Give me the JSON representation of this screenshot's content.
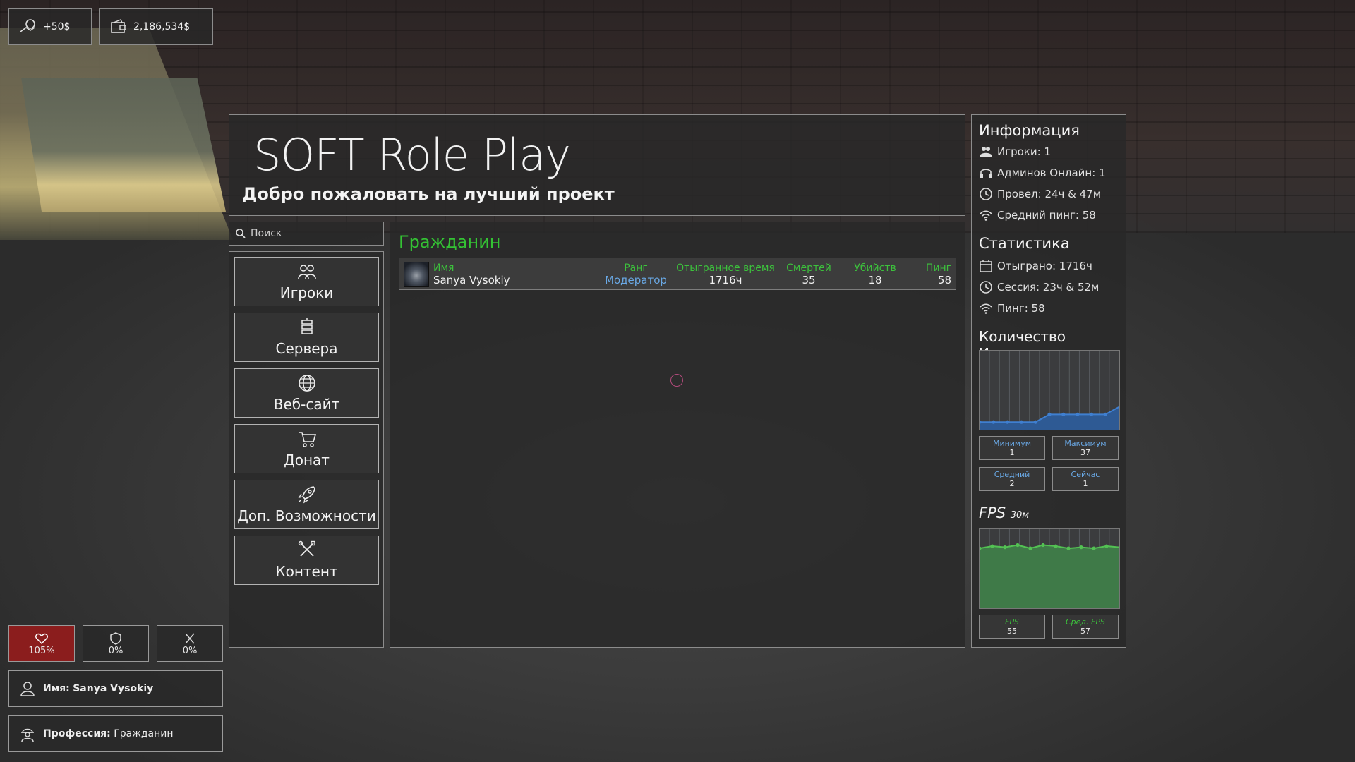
{
  "hud": {
    "income": "+50$",
    "balance": "2,186,534$",
    "health": "105%",
    "armor": "0%",
    "hunger": "0%",
    "name_label": "Имя:",
    "name_value": "Sanya Vysokiy",
    "job_label": "Профессия:",
    "job_value": "Гражданин"
  },
  "header": {
    "title": "SOFT Role Play",
    "subtitle": "Добро пожаловать на лучший проект"
  },
  "search": {
    "placeholder": "Поиск"
  },
  "menu": {
    "items": [
      {
        "label": "Игроки",
        "icon": "users-icon"
      },
      {
        "label": "Сервера",
        "icon": "servers-icon"
      },
      {
        "label": "Веб-сайт",
        "icon": "globe-icon"
      },
      {
        "label": "Донат",
        "icon": "cart-icon"
      },
      {
        "label": "Доп. Возможности",
        "icon": "rocket-icon"
      },
      {
        "label": "Контент",
        "icon": "tools-icon"
      }
    ]
  },
  "content": {
    "section_title": "Гражданин",
    "columns": {
      "name": "Имя",
      "rank": "Ранг",
      "playtime": "Отыгранное время",
      "deaths": "Смертей",
      "kills": "Убийств",
      "ping": "Пинг"
    },
    "players": [
      {
        "name": "Sanya Vysokiy",
        "rank": "Модератор",
        "playtime": "1716ч",
        "deaths": "35",
        "kills": "18",
        "ping": "58"
      }
    ]
  },
  "info": {
    "title": "Информация",
    "players": "Игроки: 1",
    "admins": "Админов Онлайн: 1",
    "spent": "Провел: 24ч & 47м",
    "avg_ping": "Средний пинг: 58",
    "stats_title": "Статистика",
    "played": "Отыграно: 1716ч",
    "session": "Сессия: 23ч & 52м",
    "ping": "Пинг: 58",
    "player_count_title": "Количество Игроков",
    "min_label": "Минимум",
    "min_value": "1",
    "max_label": "Максимум",
    "max_value": "37",
    "avg_label": "Средний",
    "avg_value": "2",
    "now_label": "Сейчас",
    "now_value": "1",
    "fps_title": "FPS",
    "fps_period": "30м",
    "fps_label": "FPS",
    "fps_value": "55",
    "avg_fps_label": "Сред. FPS",
    "avg_fps_value": "57"
  },
  "colors": {
    "accent_green": "#34c334",
    "accent_blue": "#6aa9e6",
    "health_red": "#8b1d1d"
  },
  "chart_data": [
    {
      "type": "area",
      "title": "Количество Игроков",
      "series": [
        {
          "values": [
            1,
            1,
            1,
            1,
            1,
            2,
            2,
            2,
            2,
            2,
            3
          ]
        }
      ],
      "ylim": [
        0,
        10
      ]
    },
    {
      "type": "area",
      "title": "FPS",
      "series": [
        {
          "values": [
            55,
            57,
            56,
            58,
            55,
            58,
            57,
            55,
            56,
            55,
            57,
            56
          ]
        }
      ],
      "ylim": [
        0,
        70
      ]
    }
  ]
}
